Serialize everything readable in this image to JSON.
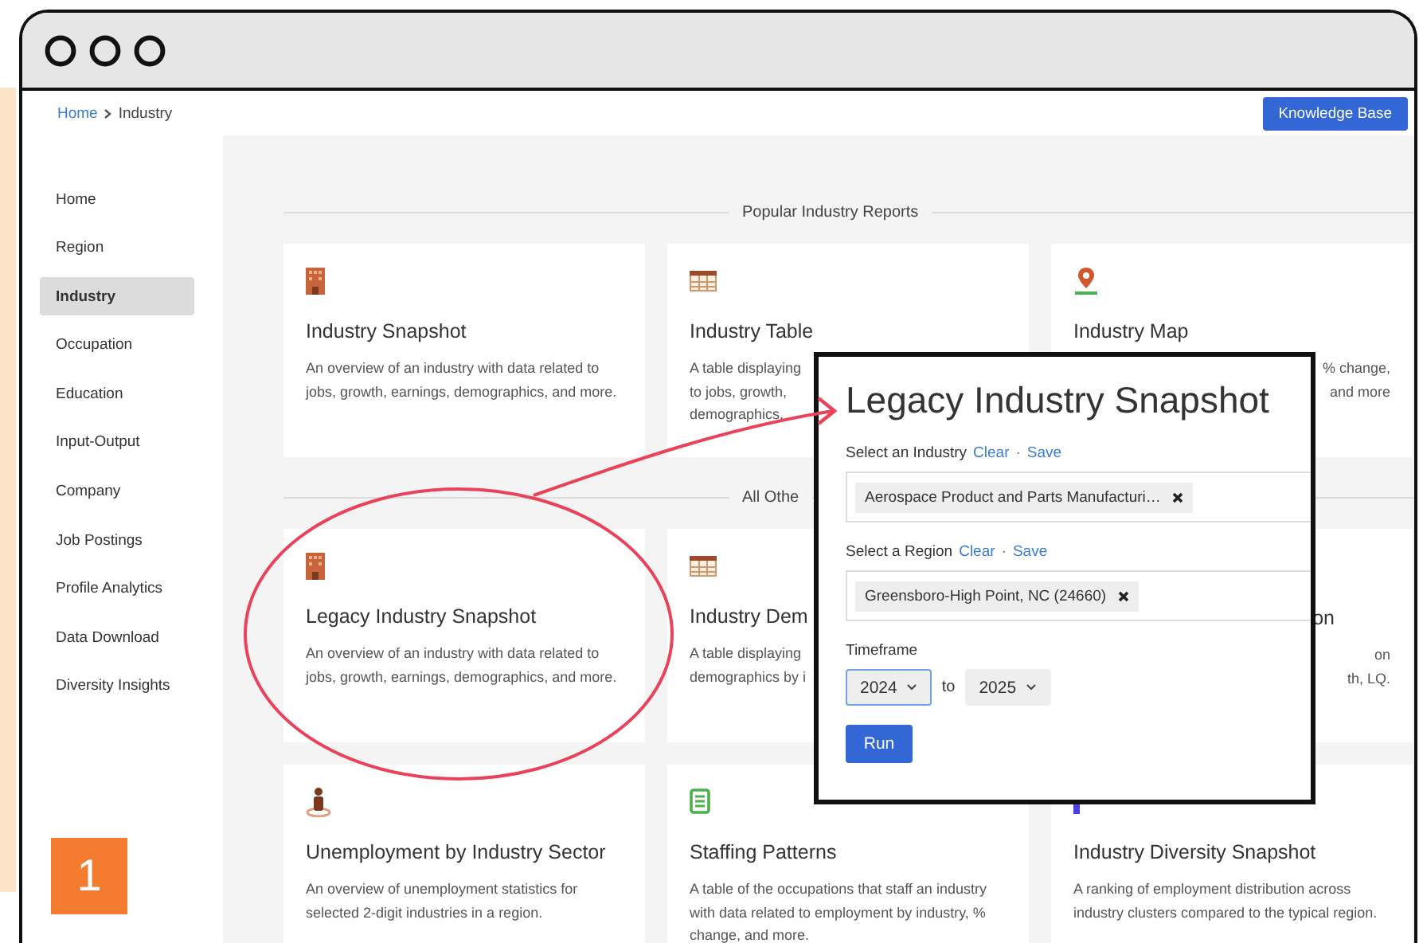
{
  "breadcrumb": [
    {
      "label": "Home",
      "kind": "link"
    },
    {
      "label": "Industry",
      "kind": "current"
    }
  ],
  "header_button": "Knowledge Base",
  "sidebar": {
    "items": [
      {
        "label": "Home",
        "selected": false
      },
      {
        "label": "Region",
        "selected": false
      },
      {
        "label": "Industry",
        "selected": true
      },
      {
        "label": "Occupation",
        "selected": false
      },
      {
        "label": "Education",
        "selected": false
      },
      {
        "label": "Input-Output",
        "selected": false
      },
      {
        "label": "Company",
        "selected": false
      },
      {
        "label": "Job Postings",
        "selected": false
      },
      {
        "label": "Profile Analytics",
        "selected": false
      },
      {
        "label": "Data Download",
        "selected": false
      },
      {
        "label": "Diversity Insights",
        "selected": false
      }
    ]
  },
  "sections": [
    {
      "heading": "Popular Industry Reports",
      "cards": [
        {
          "kind": "building",
          "title": "Industry Snapshot",
          "description": "An overview of an industry with data related to jobs, growth, earnings, demographics, and more."
        },
        {
          "kind": "table",
          "title": "Industry Table",
          "description_lines": [
            "A table displaying",
            "to jobs, growth,",
            "demographics,"
          ]
        },
        {
          "kind": "pin",
          "title": "Industry Map",
          "description_lines": [
            "% change,",
            "and more"
          ]
        }
      ]
    },
    {
      "heading": "All Othe",
      "cards": [
        {
          "kind": "building",
          "title": "Legacy Industry Snapshot",
          "description": "An overview of an industry with data related to jobs, growth, earnings, demographics, and more."
        },
        {
          "kind": "table",
          "title": "Industry Dem",
          "description_lines": [
            "A table displaying",
            "demographics by i"
          ]
        },
        {
          "kind": "hidden",
          "title": "on",
          "description_lines": [
            "on",
            "th, LQ."
          ]
        },
        {
          "kind": "person",
          "title": "Unemployment by Industry Sector",
          "description": "An overview of unemployment statistics for selected 2-digit industries in a region."
        },
        {
          "kind": "document",
          "title": "Staffing Patterns",
          "description": "A table of the occupations that staff an industry with data related to employment by industry, % change, and more."
        },
        {
          "kind": "flag",
          "title": "Industry Diversity Snapshot",
          "description": "A ranking of employment distribution across industry clusters compared to the typical region."
        }
      ]
    }
  ],
  "dialog": {
    "title": "Legacy Industry Snapshot",
    "fields": [
      {
        "label": "Select an Industry",
        "actions": [
          "Clear",
          "Save"
        ],
        "separator": "·",
        "chip": "Aerospace Product and Parts Manufacturi…"
      },
      {
        "label": "Select a Region",
        "actions": [
          "Clear",
          "Save"
        ],
        "separator": "·",
        "chip": "Greensboro-High Point, NC (24660)"
      }
    ],
    "timeframe": {
      "label": "Timeframe",
      "selects": [
        {
          "value": "2024",
          "focused": true
        },
        {
          "value": "2025",
          "focused": false
        }
      ],
      "connector": "to"
    },
    "run_button": "Run"
  },
  "step_badge": "1"
}
